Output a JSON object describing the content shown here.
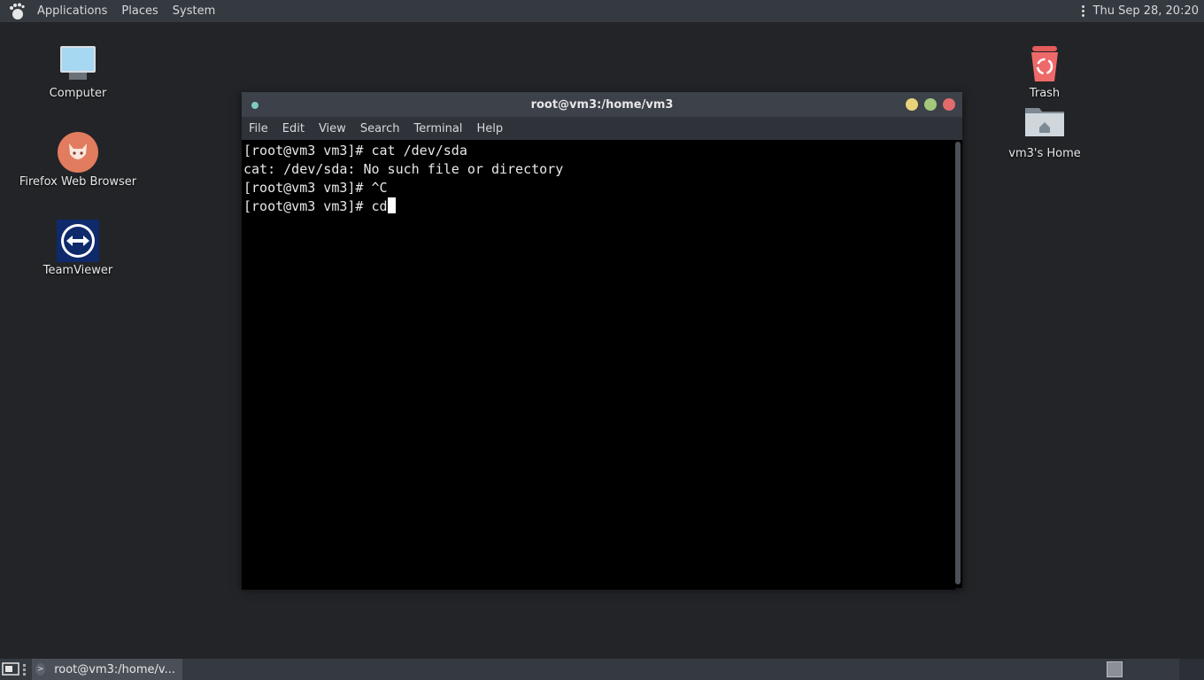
{
  "top_panel": {
    "menus": [
      "Applications",
      "Places",
      "System"
    ],
    "clock": "Thu Sep 28, 20:20",
    "icons": {
      "logo": "gnome-foot-icon",
      "overflow": "vertical-dots-icon"
    }
  },
  "desktop_icons": {
    "computer": {
      "label": "Computer",
      "icon": "computer-icon"
    },
    "firefox": {
      "label": "Firefox Web Browser",
      "icon": "firefox-icon"
    },
    "teamviewer": {
      "label": "TeamViewer",
      "icon": "teamviewer-icon"
    },
    "trash": {
      "label": "Trash",
      "icon": "trash-icon"
    },
    "home": {
      "label": "vm3's Home",
      "icon": "home-folder-icon"
    }
  },
  "terminal": {
    "title": "root@vm3:/home/vm3",
    "menu": [
      "File",
      "Edit",
      "View",
      "Search",
      "Terminal",
      "Help"
    ],
    "lines": [
      "[root@vm3 vm3]# cat /dev/sda",
      "cat: /dev/sda: No such file or directory",
      "[root@vm3 vm3]# ^C",
      "[root@vm3 vm3]# cd"
    ],
    "colors": {
      "minimize": "#e8d27a",
      "maximize": "#a5c77c",
      "close": "#e36b6b",
      "dot": "#7fc9c2"
    }
  },
  "bottom_panel": {
    "task_label": "root@vm3:/home/v...",
    "icons": {
      "show_desktop": "show-desktop-icon",
      "task": "terminal-icon"
    }
  }
}
